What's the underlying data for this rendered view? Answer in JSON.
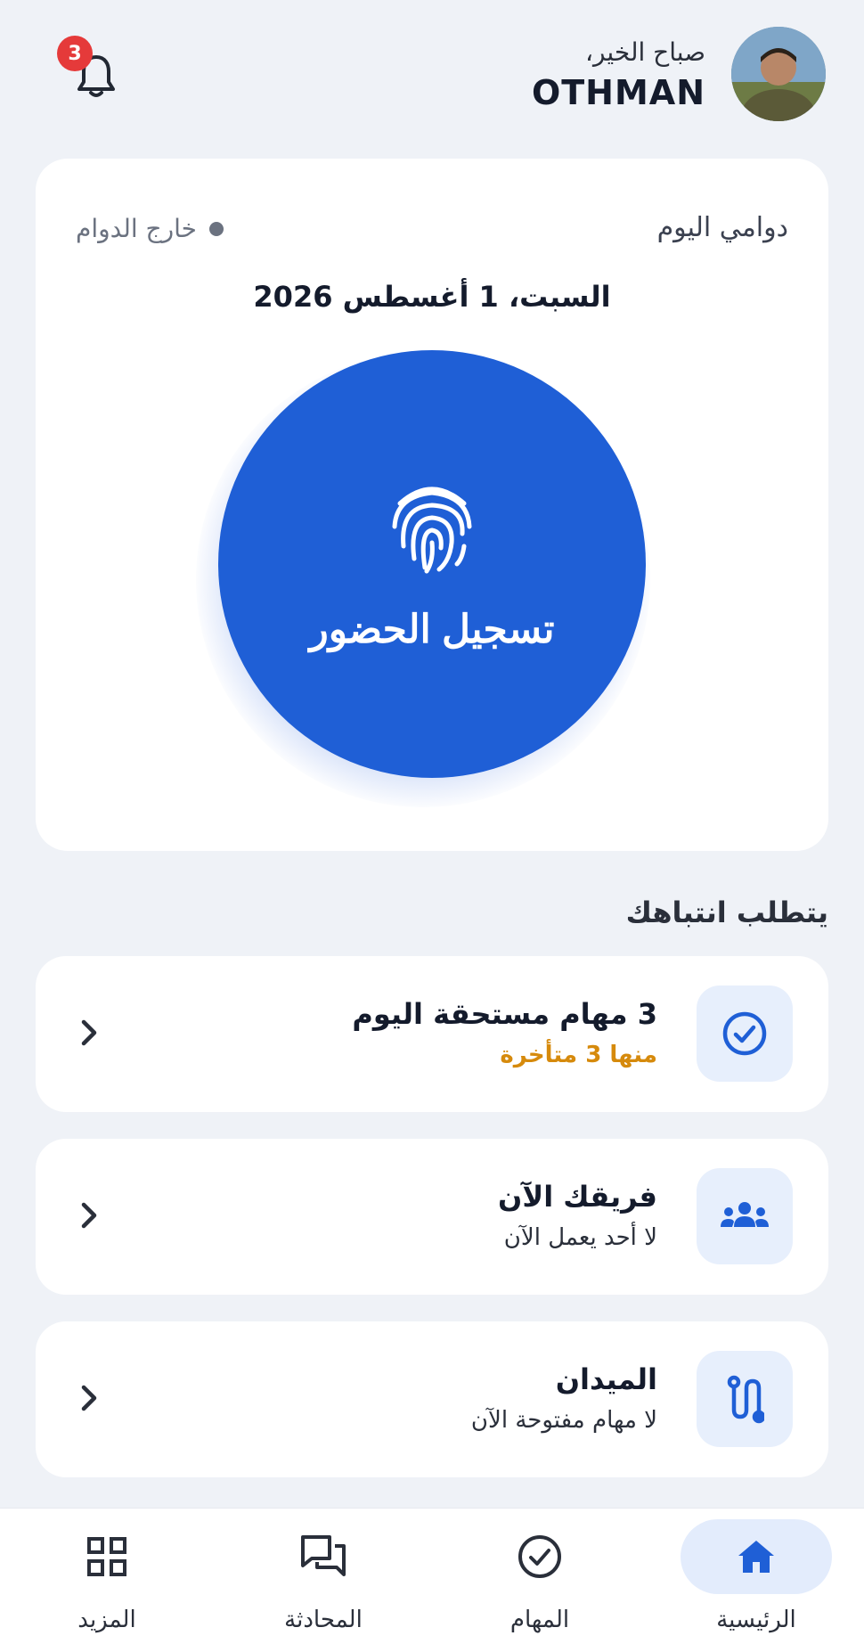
{
  "header": {
    "greeting": "صباح الخير،",
    "username": "OTHMAN",
    "notifications_count": "3"
  },
  "shift": {
    "title": "دوامي اليوم",
    "status": "خارج الدوام",
    "date": "السبت، 1 أغسطس 2026",
    "checkin_label": "تسجيل الحضور"
  },
  "attention": {
    "title": "يتطلب انتباهك",
    "items": [
      {
        "title": "3 مهام مستحقة اليوم",
        "subtitle": "منها 3 متأخرة",
        "icon": "check-circle-icon"
      },
      {
        "title": "فريقك الآن",
        "subtitle": "لا أحد يعمل الآن",
        "icon": "team-icon"
      },
      {
        "title": "الميدان",
        "subtitle": "لا مهام مفتوحة الآن",
        "icon": "route-icon"
      }
    ]
  },
  "nav": {
    "items": [
      {
        "label": "الرئيسية",
        "icon": "home-icon",
        "active": true
      },
      {
        "label": "المهام",
        "icon": "check-circle-icon"
      },
      {
        "label": "المحادثة",
        "icon": "chat-icon"
      },
      {
        "label": "المزيد",
        "icon": "grid-icon"
      }
    ]
  },
  "colors": {
    "primary": "#1f5fd6",
    "background": "#eff2f7",
    "warning": "#d68a0c",
    "badge": "#e53a3a"
  }
}
